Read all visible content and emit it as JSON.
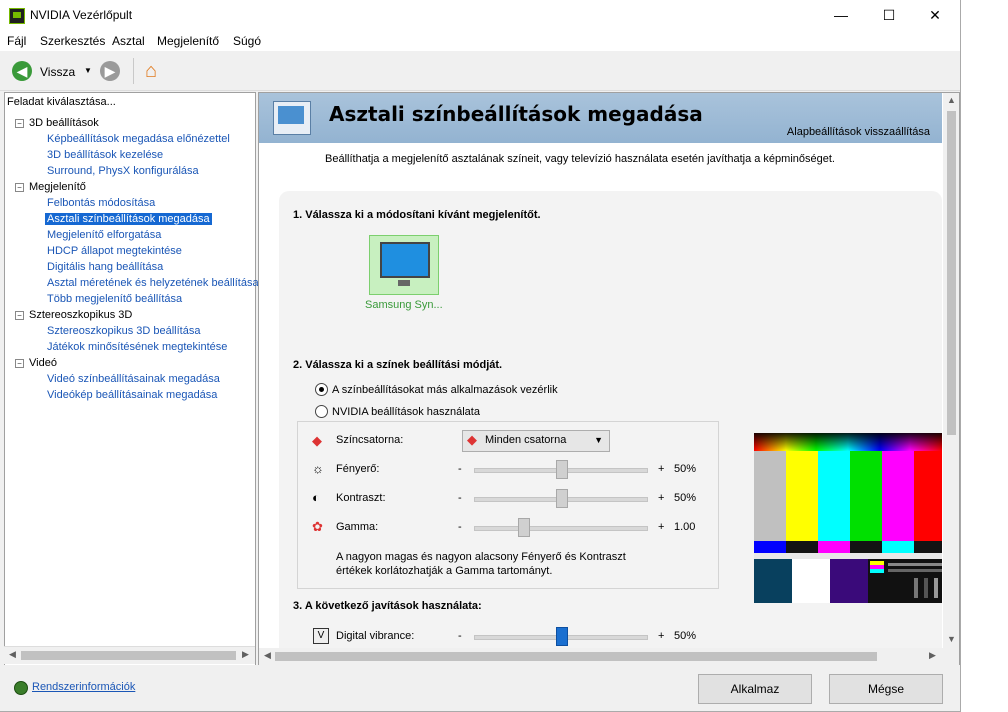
{
  "window": {
    "title": "NVIDIA Vezérlőpult",
    "minimize": "—",
    "maximize": "☐",
    "close": "✕"
  },
  "menu": [
    "Fájl",
    "Szerkesztés",
    "Asztal",
    "Megjelenítő",
    "Súgó"
  ],
  "toolbar": {
    "back_label": "Vissza",
    "back_icon": "back-arrow-icon",
    "forward_icon": "forward-arrow-icon",
    "home_icon": "home-icon"
  },
  "left": {
    "header": "Feladat kiválasztása...",
    "tree": [
      {
        "label": "3D beállítások",
        "level": 0
      },
      {
        "label": "Képbeállítások megadása előnézettel",
        "level": 1
      },
      {
        "label": "3D beállítások kezelése",
        "level": 1
      },
      {
        "label": "Surround, PhysX konfigurálása",
        "level": 1
      },
      {
        "label": "Megjelenítő",
        "level": 0
      },
      {
        "label": "Felbontás módosítása",
        "level": 1
      },
      {
        "label": "Asztali színbeállítások megadása",
        "level": 1,
        "selected": true
      },
      {
        "label": "Megjelenítő elforgatása",
        "level": 1
      },
      {
        "label": "HDCP állapot megtekintése",
        "level": 1
      },
      {
        "label": "Digitális hang beállítása",
        "level": 1
      },
      {
        "label": "Asztal méretének és helyzetének beállítása",
        "level": 1
      },
      {
        "label": "Több megjelenítő beállítása",
        "level": 1
      },
      {
        "label": "Sztereoszkopikus 3D",
        "level": 0
      },
      {
        "label": "Sztereoszkopikus 3D beállítása",
        "level": 1
      },
      {
        "label": "Játékok minősítésének megtekintése",
        "level": 1
      },
      {
        "label": "Videó",
        "level": 0
      },
      {
        "label": "Videó színbeállításainak megadása",
        "level": 1
      },
      {
        "label": "Videókép beállításainak megadása",
        "level": 1
      }
    ]
  },
  "page": {
    "title": "Asztali színbeállítások megadása",
    "reset": "Alapbeállítások visszaállítása",
    "description": "Beállíthatja a megjelenítő asztalának színeit, vagy televízió használata esetén javíthatja a képminőséget.",
    "section1": "1. Válassza ki a módosítani kívánt megjelenítőt.",
    "monitor_label": "Samsung Syn...",
    "section2": "2. Válassza ki a színek beállítási módját.",
    "radio1": "A színbeállításokat más alkalmazások vezérlik",
    "radio2": "NVIDIA beállítások használata",
    "channel_label": "Színcsatorna:",
    "channel_value": "Minden csatorna",
    "brightness_label": "Fényerő:",
    "brightness_value": "50%",
    "contrast_label": "Kontraszt:",
    "contrast_value": "50%",
    "gamma_label": "Gamma:",
    "gamma_value": "1.00",
    "minus": "-",
    "plus": "+",
    "note": "A nagyon magas és nagyon alacsony Fényerő és Kontraszt értékek korlátozhatják a Gamma tartományt.",
    "section3": "3. A következő javítások használata:",
    "vibrance_label": "Digital vibrance:",
    "vibrance_value": "50%"
  },
  "footer": {
    "sysinfo": "Rendszerinformációk",
    "apply": "Alkalmaz",
    "cancel": "Mégse"
  }
}
